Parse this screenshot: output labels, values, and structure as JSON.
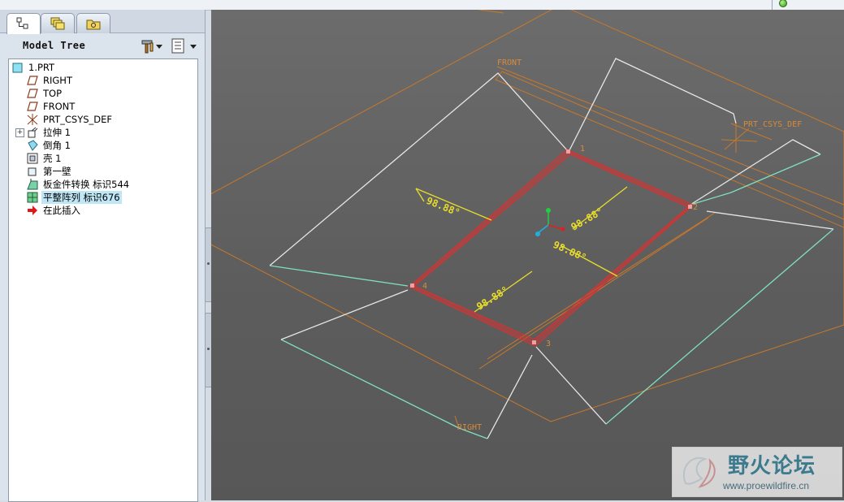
{
  "tabs": [
    {
      "name": "model-tree",
      "active": true
    },
    {
      "name": "layers",
      "active": false
    },
    {
      "name": "folder-browser",
      "active": false
    }
  ],
  "model_tree": {
    "title": "Model Tree",
    "tools_icon": "hammer-icon",
    "settings_icon": "tree-settings-icon",
    "items": [
      {
        "label": "1.PRT",
        "icon": "part-icon",
        "indent": 0,
        "selected": false
      },
      {
        "label": "RIGHT",
        "icon": "datum-plane-icon",
        "indent": 1,
        "selected": false
      },
      {
        "label": "TOP",
        "icon": "datum-plane-icon",
        "indent": 1,
        "selected": false
      },
      {
        "label": "FRONT",
        "icon": "datum-plane-icon",
        "indent": 1,
        "selected": false
      },
      {
        "label": "PRT_CSYS_DEF",
        "icon": "csys-icon",
        "indent": 1,
        "selected": false
      },
      {
        "label": "拉伸 1",
        "icon": "extrude-icon",
        "indent": 1,
        "selected": false,
        "expandable": true
      },
      {
        "label": "倒角 1",
        "icon": "chamfer-icon",
        "indent": 1,
        "selected": false
      },
      {
        "label": "壳 1",
        "icon": "shell-icon",
        "indent": 1,
        "selected": false
      },
      {
        "label": "第一壁",
        "icon": "wall-icon",
        "indent": 1,
        "selected": false
      },
      {
        "label": "板金件转换 标识544",
        "icon": "conversion-icon",
        "indent": 1,
        "selected": false
      },
      {
        "label": "平整阵列 标识676",
        "icon": "flat-pattern-icon",
        "indent": 1,
        "selected": true
      },
      {
        "label": "在此插入",
        "icon": "insert-here-arrow-icon",
        "indent": 1,
        "selected": false
      }
    ]
  },
  "viewport": {
    "datum_labels": {
      "front": "FRONT",
      "right": "RIGHT",
      "csys": "PRT_CSYS_DEF"
    },
    "corner_labels": [
      "1",
      "2",
      "3",
      "4"
    ],
    "dimensions": [
      "98.88°",
      "98.88°",
      "98.88°",
      "98.88°"
    ],
    "colors": {
      "background": "#5f5f5f",
      "edge_white": "#e6e6e6",
      "edge_green": "#7fe0c0",
      "highlight_red": "#d83232",
      "datum_orange": "#c8782a",
      "dimension_yellow": "#e8dd2a"
    }
  },
  "watermark": {
    "title": "野火论坛",
    "url": "www.proewildfire.cn"
  }
}
